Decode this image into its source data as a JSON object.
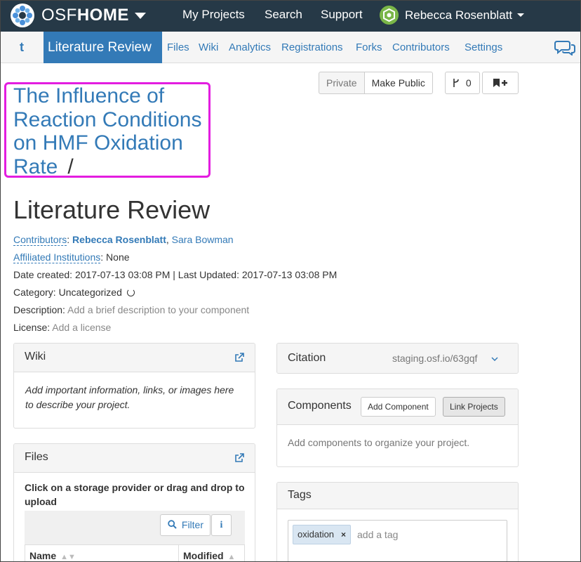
{
  "topnav": {
    "brand_light": "OSF",
    "brand_bold": "HOME",
    "links": [
      "My Projects",
      "Search",
      "Support"
    ],
    "user_name": "Rebecca Rosenblatt"
  },
  "subnav": {
    "up_label": "t",
    "active": "Literature Review",
    "links": [
      "Files",
      "Wiki",
      "Analytics",
      "Registrations",
      "Forks",
      "Contributors",
      "Settings"
    ]
  },
  "actions": {
    "private": "Private",
    "make_public": "Make Public",
    "fork_count": "0"
  },
  "parent_title": "The Influence of Reaction Conditions on HMF Oxidation Rate",
  "separator": "/",
  "title": "Literature Review",
  "meta": {
    "contributors_label": "Contributors",
    "contributor_1": "Rebecca Rosenblatt",
    "contributor_2": "Sara Bowman",
    "institutions_label": "Affiliated Institutions",
    "institutions_value": "None",
    "dates": "Date created: 2017-07-13 03:08 PM | Last Updated: 2017-07-13 03:08 PM",
    "category_label": "Category:",
    "category_value": "Uncategorized",
    "description_label": "Description:",
    "description_value": "Add a brief description to your component",
    "license_label": "License:",
    "license_value": "Add a license"
  },
  "wiki": {
    "title": "Wiki",
    "body": "Add important information, links, or images here to describe your project."
  },
  "files": {
    "title": "Files",
    "instructions": "Click on a storage provider or drag and drop to upload",
    "filter": "Filter",
    "info": "i",
    "col_name": "Name",
    "col_modified": "Modified"
  },
  "citation": {
    "title": "Citation",
    "url": "staging.osf.io/63gqf"
  },
  "components": {
    "title": "Components",
    "add": "Add Component",
    "link": "Link Projects",
    "body": "Add components to organize your project."
  },
  "tags": {
    "title": "Tags",
    "items": [
      "oxidation"
    ],
    "placeholder": "add a tag"
  },
  "colors": {
    "navbar": "#263947",
    "accent": "#337ab7",
    "highlight": "#e31de0"
  }
}
